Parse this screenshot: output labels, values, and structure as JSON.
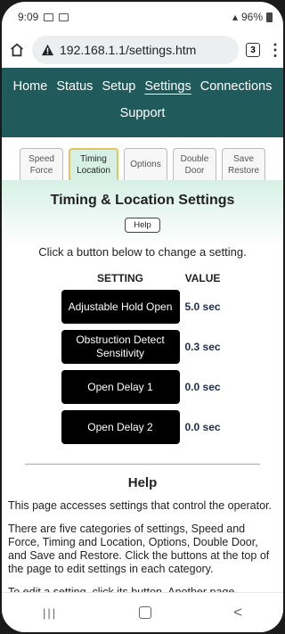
{
  "status_bar": {
    "time": "9:09",
    "battery": "96%"
  },
  "browser": {
    "url": "192.168.1.1/settings.htm",
    "tab_count": "3",
    "menu_glyph": "⋮"
  },
  "nav": {
    "row1": [
      "Home",
      "Status",
      "Setup",
      "Settings",
      "Connections"
    ],
    "row2": "Support",
    "active": "Settings"
  },
  "tabs": [
    {
      "label": "Speed Force",
      "active": false
    },
    {
      "label": "Timing Location",
      "active": true
    },
    {
      "label": "Options",
      "active": false
    },
    {
      "label": "Double Door",
      "active": false
    },
    {
      "label": "Save Restore",
      "active": false
    }
  ],
  "page": {
    "title": "Timing & Location Settings",
    "help_button": "Help",
    "instruction": "Click a button below to change a setting.",
    "col_setting": "SETTING",
    "col_value": "VALUE",
    "settings": [
      {
        "label": "Adjustable Hold Open",
        "value": "5.0 sec"
      },
      {
        "label": "Obstruction Detect Sensitivity",
        "value": "0.3 sec"
      },
      {
        "label": "Open Delay 1",
        "value": "0.0 sec"
      },
      {
        "label": "Open Delay 2",
        "value": "0.0 sec"
      }
    ]
  },
  "help": {
    "title": "Help",
    "paragraphs": [
      "This page accesses settings that control the operator.",
      "There are five categories of settings, Speed and Force, Timing and Location, Options, Double Door, and Save and Restore. Click the buttons at the top of the page to edit settings in each category.",
      "To edit a setting, click its button. Another page appears to adjust the setting, and you will find a full"
    ]
  },
  "system_nav": {
    "recents": "|||",
    "back": "<"
  },
  "colors": {
    "nav_bg": "#215a5a",
    "active_tab_border": "#e3c35a",
    "content_gradient": "#d6f0e6",
    "value_text": "#1f2d4a"
  }
}
